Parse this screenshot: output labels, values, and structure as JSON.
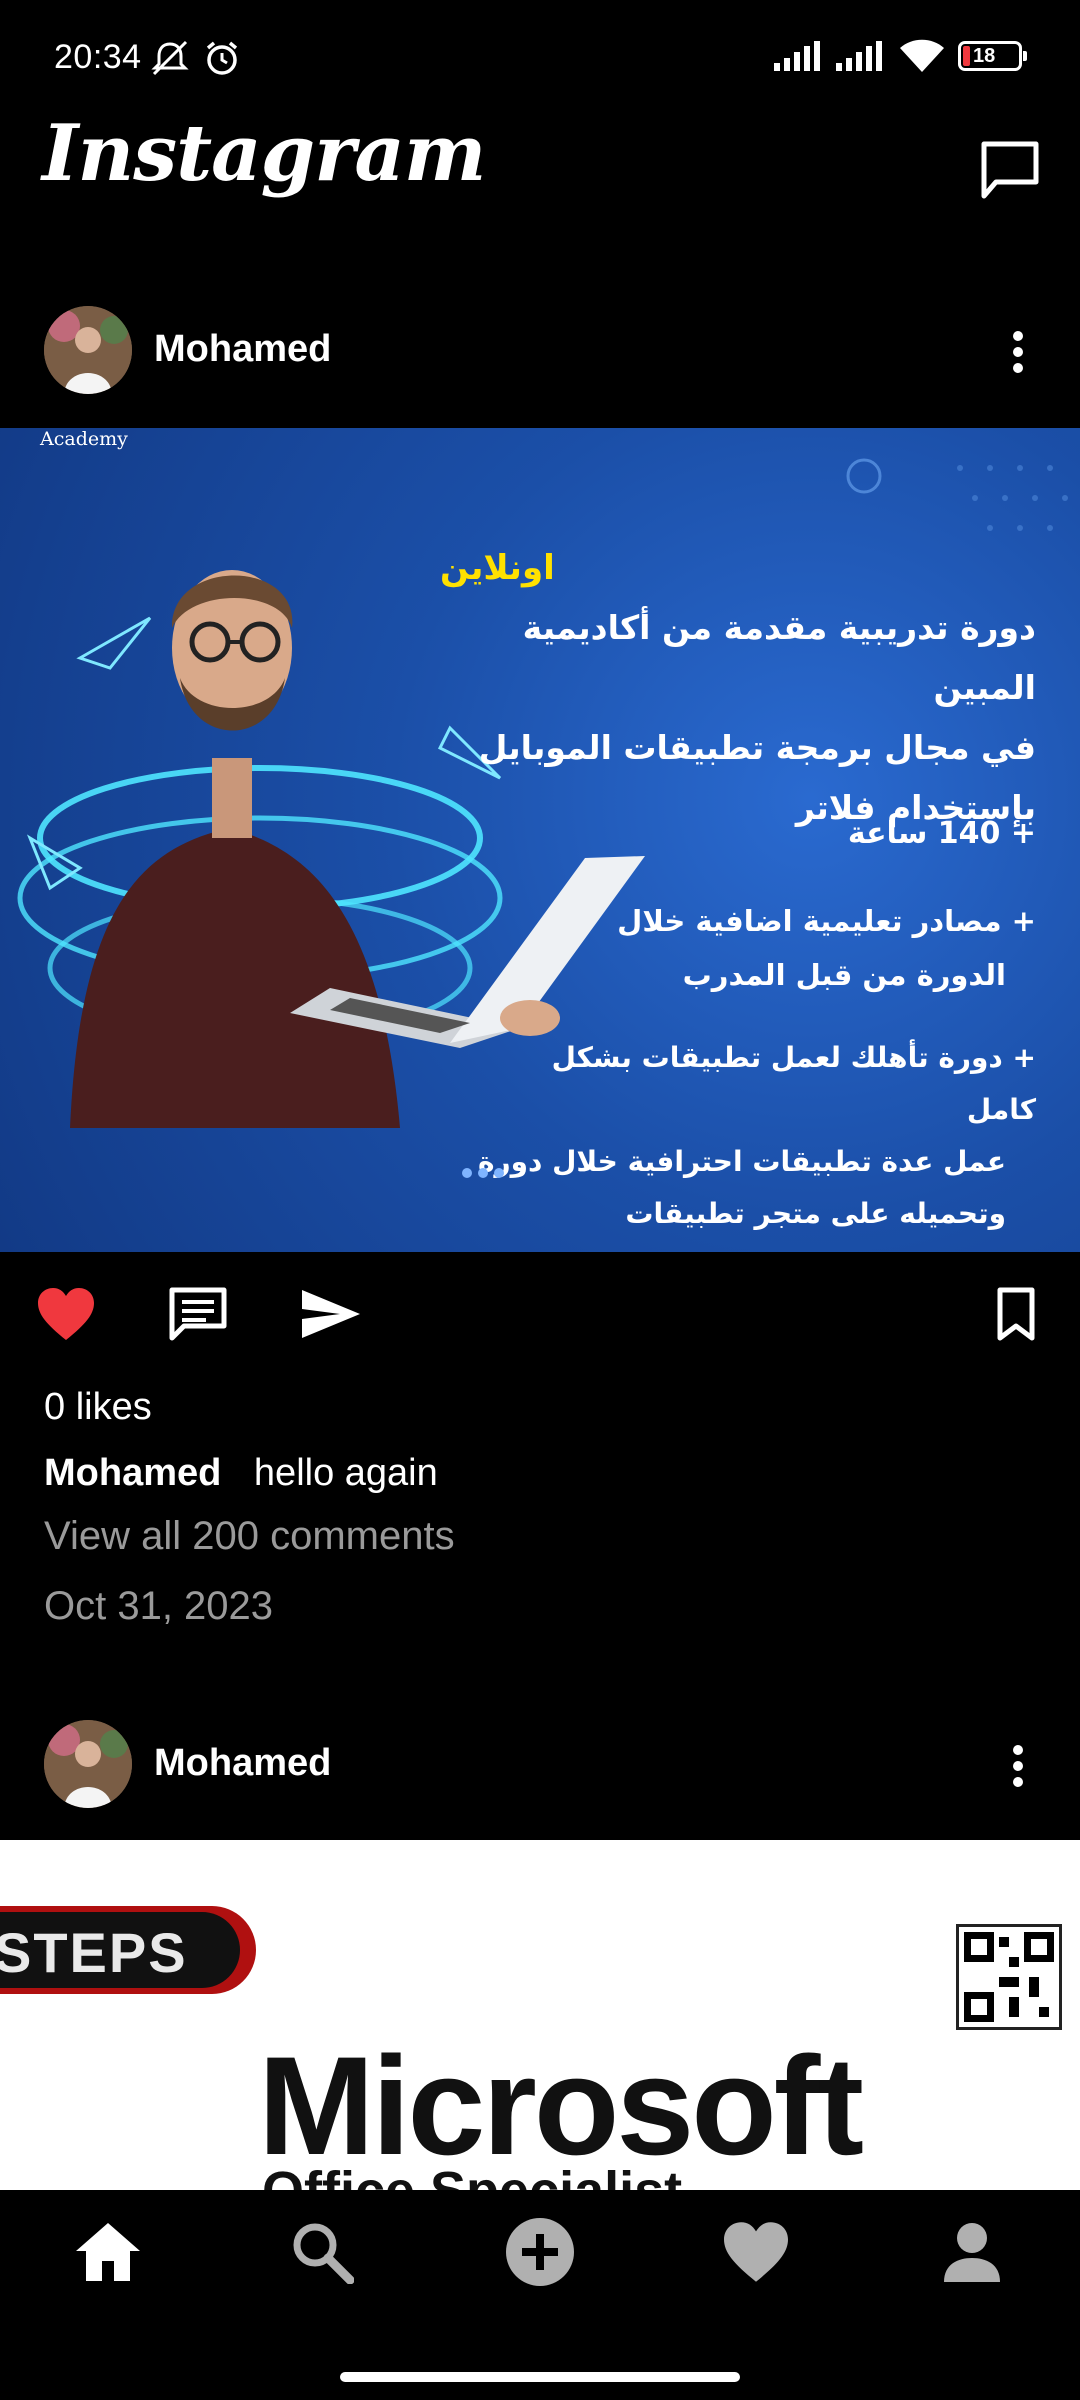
{
  "status_bar": {
    "time": "20:34",
    "battery": "18",
    "icons": [
      "mute-icon",
      "alarm-icon",
      "signal-icon",
      "signal-icon",
      "wifi-icon",
      "battery-icon"
    ]
  },
  "header": {
    "logo": "Instagram",
    "dm_icon": "message-icon"
  },
  "posts": [
    {
      "username": "Mohamed",
      "image": {
        "corner_text": "Academy",
        "tag": "اونلاين",
        "headline": [
          "دورة تدريبية مقدمة من أكاديمية المبين",
          "في مجال برمجة تطبيقات الموبايل",
          "بإستخدام فلاتر"
        ],
        "bullet1": "+ 140 ساعة",
        "bullet2": [
          "+ مصادر تعليمية اضافية خلال",
          "الدورة من قبل المدرب"
        ],
        "bullet3": [
          "+ دورة تأهلك لعمل تطبيقات بشكل كامل",
          "عمل عدة تطبيقات احترافية خلال دورة",
          "وتحميله على متجر تطبيقات"
        ]
      },
      "likes": "0 likes",
      "caption_user": "Mohamed",
      "caption_text": "hello again",
      "view_comments": "View all 200 comments",
      "date": "Oct 31, 2023",
      "liked": true
    },
    {
      "username": "Mohamed",
      "image": {
        "badge_text": "STEPS",
        "title": "Microsoft",
        "subtitle": "Office Specialist"
      }
    }
  ],
  "bottom_nav": {
    "items": [
      "home-icon",
      "search-icon",
      "add-icon",
      "heart-icon",
      "profile-icon"
    ]
  },
  "colors": {
    "like_red": "#f0383e",
    "post_blue": "#1b4fa8",
    "glow": "#4fe6ff",
    "tag_yellow": "#ffe100"
  }
}
